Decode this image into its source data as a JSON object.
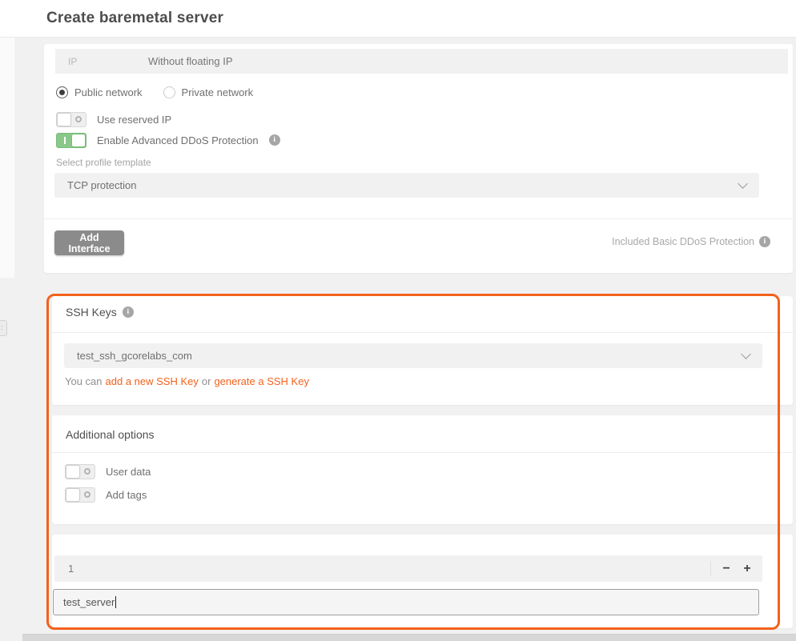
{
  "colors": {
    "accent_orange": "#f4611c",
    "toggle_green": "#8ac88a",
    "button_gray": "#8b8b8b",
    "card_background": "#ffffff",
    "page_background": "#f1f1f2"
  },
  "icons": {
    "info_glyph": "i",
    "minus": "−",
    "plus": "+"
  },
  "header": {
    "title": "Create baremetal server"
  },
  "interface_card": {
    "ip_row": {
      "label": "IP",
      "value": "Without floating IP"
    },
    "radios": [
      {
        "label": "Public network",
        "selected": true
      },
      {
        "label": "Private network",
        "selected": false
      }
    ],
    "reserved_ip_toggle": {
      "label": "Use reserved IP",
      "on": false
    },
    "ddos_toggle": {
      "label": "Enable Advanced DDoS Protection",
      "on": true
    },
    "profile_template": {
      "label": "Select profile template",
      "value": "TCP protection"
    },
    "add_interface_button": "Add Interface",
    "included_note": "Included Basic DDoS Protection"
  },
  "ssh_card": {
    "title": "SSH Keys",
    "key_select_value": "test_ssh_gcorelabs_com",
    "hint_prefix": "You can",
    "hint_link_add": "add a new SSH Key",
    "hint_or": "or",
    "hint_link_generate": "generate a SSH Key"
  },
  "options_card": {
    "title": "Additional options",
    "user_data_toggle": {
      "label": "User data",
      "on": false
    },
    "add_tags_toggle": {
      "label": "Add tags",
      "on": false
    }
  },
  "server_card": {
    "count_value": "1",
    "name_value": "test_server"
  }
}
